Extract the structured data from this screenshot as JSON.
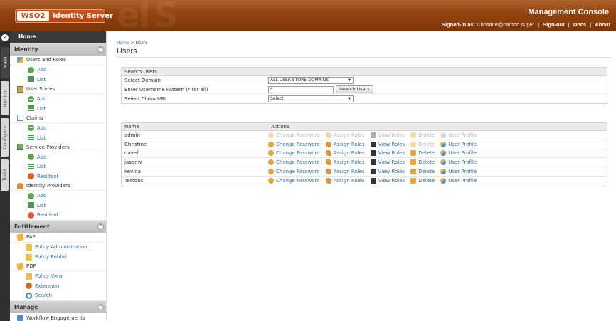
{
  "header": {
    "logo_wso": "WSO2",
    "logo_product": "Identity Server",
    "console_title": "Management Console",
    "signed_in_label": "Signed-in as:",
    "signed_in_user": "Christine@carbon.super",
    "links": [
      "Sign-out",
      "Docs",
      "About"
    ]
  },
  "vtabs": [
    "Main",
    "Monitor",
    "Configure",
    "Tools"
  ],
  "sidebar": {
    "home": "Home",
    "sections": [
      {
        "title": "Identity",
        "items": [
          {
            "label": "Users and Roles",
            "icon": "users-icon",
            "level": 1
          },
          {
            "label": "Add",
            "icon": "add-icon",
            "level": 2
          },
          {
            "label": "List",
            "icon": "list-icon",
            "level": 2
          },
          {
            "label": "User Stores",
            "icon": "user-store-icon",
            "level": 1
          },
          {
            "label": "Add",
            "icon": "add-icon",
            "level": 2
          },
          {
            "label": "List",
            "icon": "list-icon",
            "level": 2
          },
          {
            "label": "Claims",
            "icon": "claims-icon",
            "level": 1
          },
          {
            "label": "Add",
            "icon": "add-icon",
            "level": 2
          },
          {
            "label": "List",
            "icon": "list-icon",
            "level": 2
          },
          {
            "label": "Service Providers",
            "icon": "service-provider-icon",
            "level": 1
          },
          {
            "label": "Add",
            "icon": "add-icon",
            "level": 2
          },
          {
            "label": "List",
            "icon": "list-icon",
            "level": 2
          },
          {
            "label": "Resident",
            "icon": "resident-icon",
            "level": 2
          },
          {
            "label": "Identity Providers",
            "icon": "identity-provider-icon",
            "level": 1
          },
          {
            "label": "Add",
            "icon": "add-icon",
            "level": 2
          },
          {
            "label": "List",
            "icon": "list-icon",
            "level": 2
          },
          {
            "label": "Resident",
            "icon": "resident-icon",
            "level": 2
          }
        ]
      },
      {
        "title": "Entitlement",
        "items": [
          {
            "label": "PAP",
            "icon": "pap-icon",
            "level": 1
          },
          {
            "label": "Policy Administration",
            "icon": "policy-icon",
            "level": 3
          },
          {
            "label": "Policy Publish",
            "icon": "publish-icon",
            "level": 3
          },
          {
            "label": "PDP",
            "icon": "pdp-icon",
            "level": 1
          },
          {
            "label": "Policy View",
            "icon": "policy-icon",
            "level": 3
          },
          {
            "label": "Extension",
            "icon": "extension-icon",
            "level": 3
          },
          {
            "label": "Search",
            "icon": "search-icon",
            "level": 3
          }
        ]
      },
      {
        "title": "Manage",
        "items": [
          {
            "label": "Workflow Engagements",
            "icon": "workflow-icon",
            "level": 1
          }
        ]
      }
    ]
  },
  "breadcrumb": {
    "home": "Home",
    "separator": ">",
    "current": "Users"
  },
  "page_title": "Users",
  "search": {
    "title": "Search Users",
    "domain_label": "Select Domain",
    "domain_value": "ALL-USER-STORE-DOMAINS",
    "pattern_label": "Enter Username Pattern (* for all)",
    "pattern_value": "*",
    "search_button": "Search Users",
    "claim_label": "Select Claim URI",
    "claim_value": "Select"
  },
  "users_table": {
    "headers": [
      "Name",
      "Actions"
    ],
    "action_labels": [
      "Change Password",
      "Assign Roles",
      "View Roles",
      "Delete",
      "User Profile"
    ],
    "rows": [
      {
        "name": "admin",
        "disabled": true
      },
      {
        "name": "Christine",
        "disabled": false,
        "delete_disabled": true
      },
      {
        "name": "davef",
        "disabled": false
      },
      {
        "name": "jasonw",
        "disabled": false
      },
      {
        "name": "kevina",
        "disabled": false
      },
      {
        "name": "Testdoc",
        "disabled": false
      }
    ]
  },
  "colors": {
    "header": "#8c3f0b",
    "link": "#2a6fb4",
    "disabled": "#b9b9b9",
    "sidebar_dark": "#3a3a3a"
  }
}
